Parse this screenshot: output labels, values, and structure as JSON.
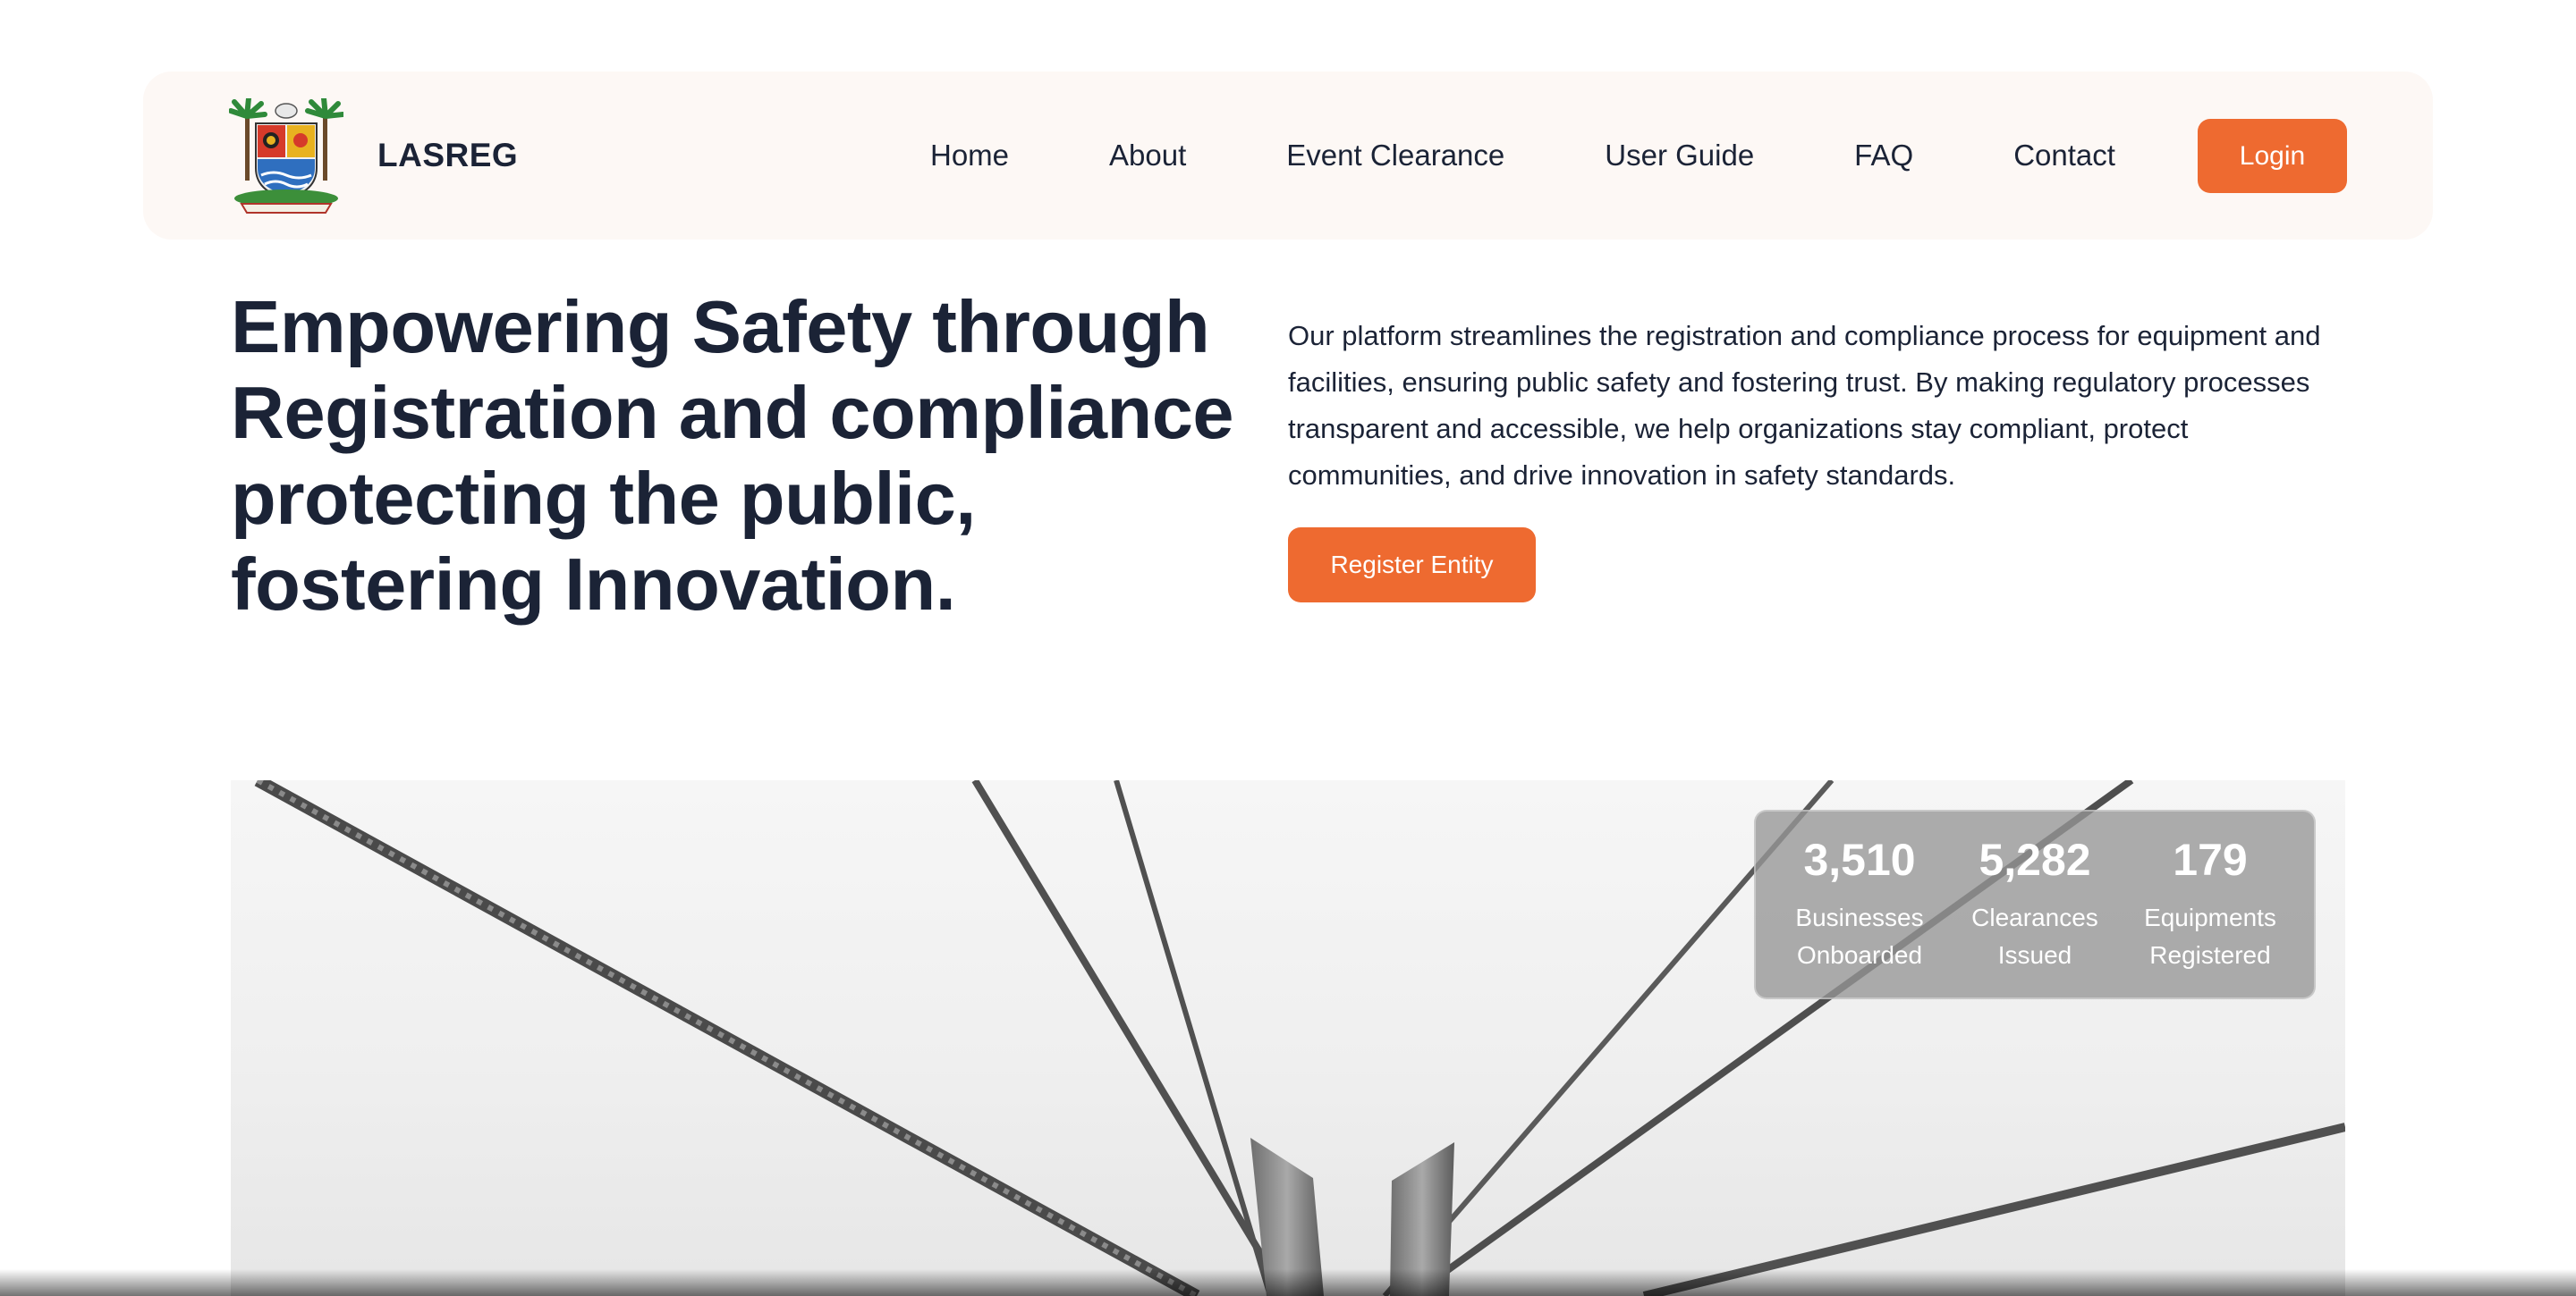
{
  "brand": {
    "name": "LASREG",
    "logo_icon": "lagos-state-coat-of-arms-icon"
  },
  "nav": {
    "items": [
      {
        "label": "Home"
      },
      {
        "label": "About"
      },
      {
        "label": "Event Clearance"
      },
      {
        "label": "User Guide"
      },
      {
        "label": "FAQ"
      },
      {
        "label": "Contact"
      }
    ],
    "login_label": "Login"
  },
  "hero": {
    "title": "Empowering Safety through Registration and compliance protecting the public, fostering Innovation.",
    "description": "Our platform streamlines the registration and compliance process for equipment and facilities, ensuring public safety and fostering trust. By making regulatory processes transparent and accessible, we help organizations stay compliant, protect communities, and drive innovation in safety standards.",
    "cta_label": "Register Entity"
  },
  "stats": [
    {
      "value": "3,510",
      "label": "Businesses Onboarded"
    },
    {
      "value": "5,282",
      "label": "Clearances Issued"
    },
    {
      "value": "179",
      "label": "Equipments Registered"
    }
  ],
  "colors": {
    "accent": "#ee6a30",
    "text": "#1b2336",
    "nav_background": "#fdf8f5"
  }
}
